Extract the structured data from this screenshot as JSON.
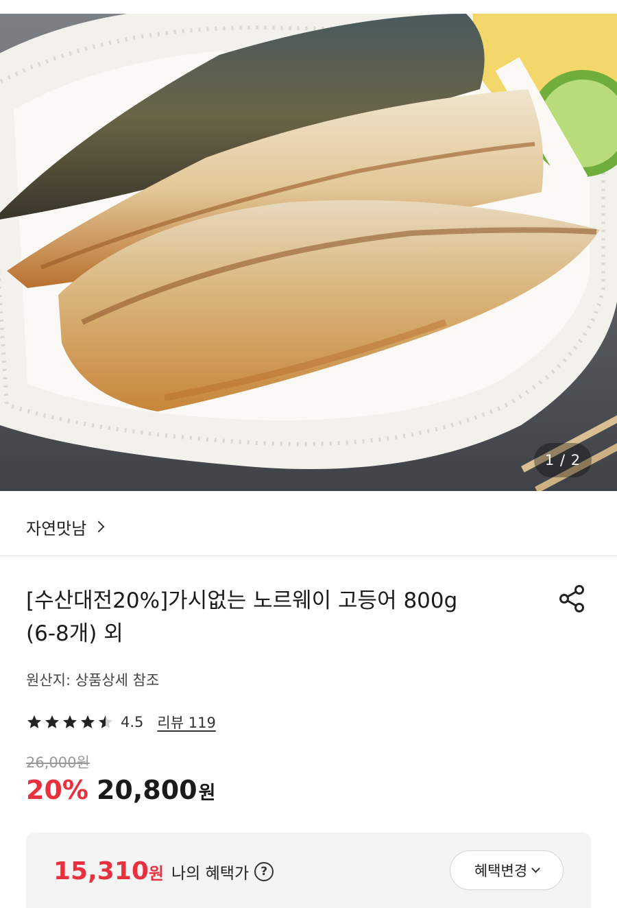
{
  "gallery": {
    "counter": "1 / 2"
  },
  "store": {
    "name": "자연맛남"
  },
  "product": {
    "title_line1": "[수산대전20%]가시없는 노르웨이 고등어 800g",
    "title_line2": "(6-8개) 외",
    "origin": "원산지: 상품상세 참조",
    "rating": "4.5",
    "rating_stars": 4.5,
    "reviews": "리뷰 119",
    "original_price": "26,000원",
    "discount": "20%",
    "price": "20,800",
    "price_unit": "원"
  },
  "benefit": {
    "price": "15,310",
    "unit": "원",
    "label": "나의 혜택가",
    "help": "?",
    "button": "혜택변경"
  },
  "colors": {
    "accent": "#e8313f",
    "text": "#1a1a1a",
    "muted": "#999999",
    "panel": "#f4f4f4"
  }
}
